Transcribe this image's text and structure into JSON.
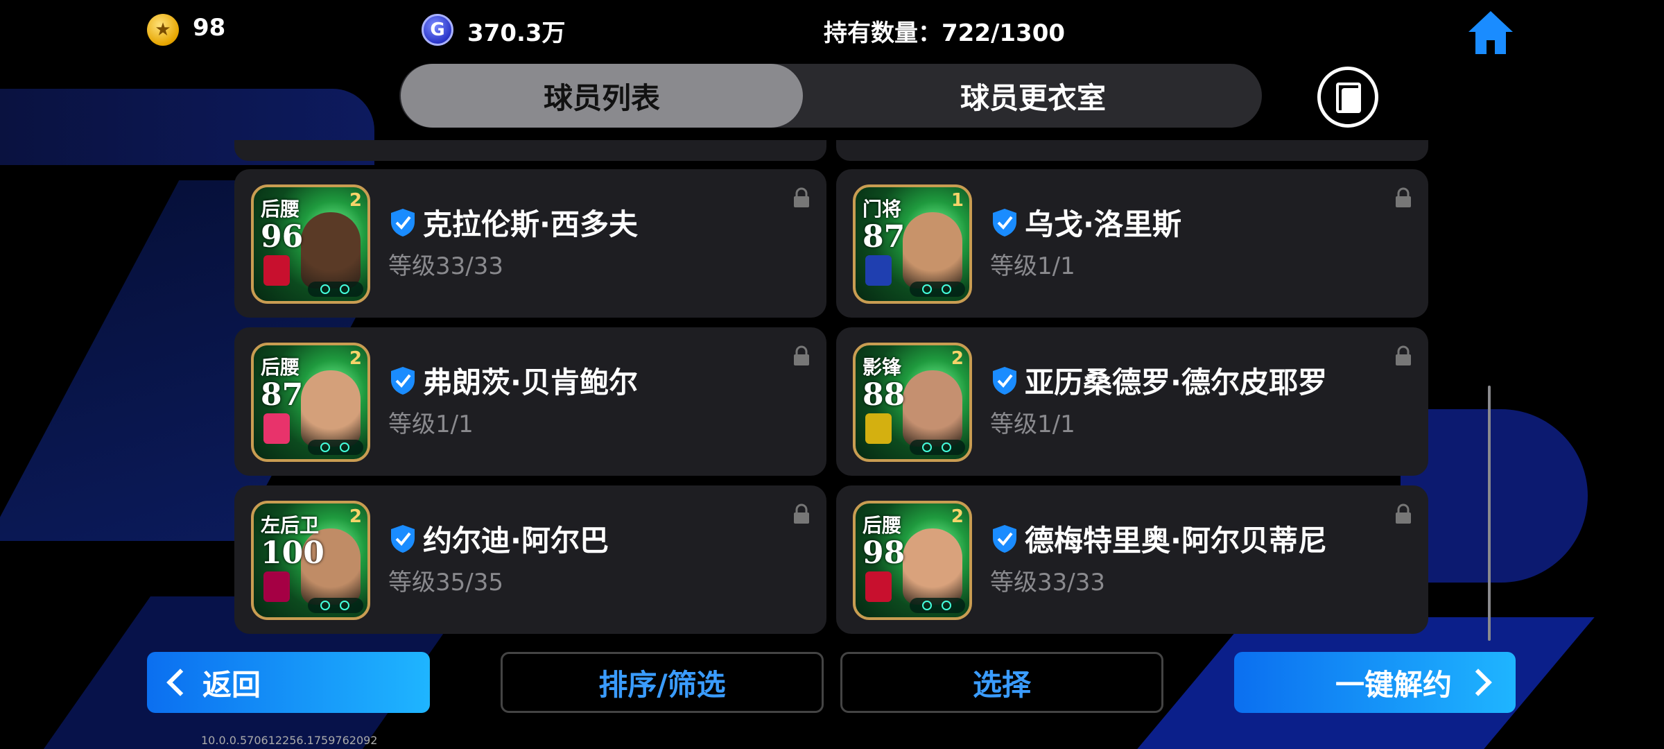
{
  "status": {
    "coins": "98",
    "gp": "370.3万",
    "holding": "持有数量：722/1300"
  },
  "tabs": [
    {
      "label": "球员列表",
      "active": true
    },
    {
      "label": "球员更衣室",
      "active": false
    }
  ],
  "players": [
    {
      "pos": "后腰",
      "rating": "96",
      "lvl": "2",
      "name": "克拉伦斯·西多夫",
      "level": "等级33/33",
      "badge_color": "#c8102e",
      "face_color": "#5a3a26"
    },
    {
      "pos": "门将",
      "rating": "87",
      "lvl": "1",
      "name": "乌戈·洛里斯",
      "level": "等级1/1",
      "badge_color": "#1f3fb0",
      "face_color": "#c8936a"
    },
    {
      "pos": "后腰",
      "rating": "87",
      "lvl": "2",
      "name": "弗朗茨·贝肯鲍尔",
      "level": "等级1/1",
      "badge_color": "#e8336b",
      "face_color": "#d4a07a"
    },
    {
      "pos": "影锋",
      "rating": "88",
      "lvl": "2",
      "name": "亚历桑德罗·德尔皮耶罗",
      "level": "等级1/1",
      "badge_color": "#d4b010",
      "face_color": "#c59070"
    },
    {
      "pos": "左后卫",
      "rating": "100",
      "lvl": "2",
      "name": "约尔迪·阿尔巴",
      "level": "等级35/35",
      "badge_color": "#a50044",
      "face_color": "#c08c66"
    },
    {
      "pos": "后腰",
      "rating": "98",
      "lvl": "2",
      "name": "德梅特里奥·阿尔贝蒂尼",
      "level": "等级33/33",
      "badge_color": "#c8102e",
      "face_color": "#d9a27c"
    }
  ],
  "buttons": {
    "back": "返回",
    "sort": "排序/筛选",
    "select": "选择",
    "release": "一键解约"
  },
  "version": "10.0.0.570612256.1759762092",
  "colors": {
    "accent_blue": "#1a8cff",
    "card_bg": "#1e1e22",
    "gold_border": "#c99d52"
  }
}
